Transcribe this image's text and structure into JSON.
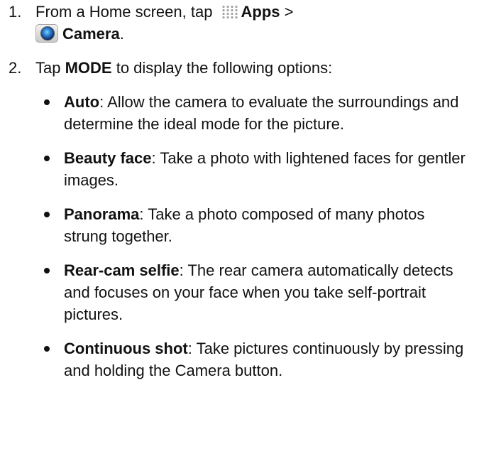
{
  "steps": [
    {
      "number": "1.",
      "text_before": "From a Home screen, tap ",
      "apps_label": "Apps",
      "sep": " >",
      "camera_label": "Camera",
      "end": "."
    },
    {
      "number": "2.",
      "text_before": "Tap ",
      "mode_label": "MODE",
      "text_after": " to display the following options:"
    }
  ],
  "options": [
    {
      "title": "Auto",
      "desc": ": Allow the camera to evaluate the surroundings and determine the ideal mode for the picture."
    },
    {
      "title": "Beauty face",
      "desc": ": Take a photo with lightened faces for gentler images."
    },
    {
      "title": "Panorama",
      "desc": ": Take a photo composed of many photos strung together."
    },
    {
      "title": "Rear-cam selfie",
      "desc": ": The rear camera automatically detects and focuses on your face when you take self-portrait pictures."
    },
    {
      "title": "Continuous shot",
      "desc": ": Take pictures continuously by pressing and holding the Camera button."
    }
  ],
  "icons": {
    "apps": "apps-grid-icon",
    "camera": "camera-app-icon"
  }
}
